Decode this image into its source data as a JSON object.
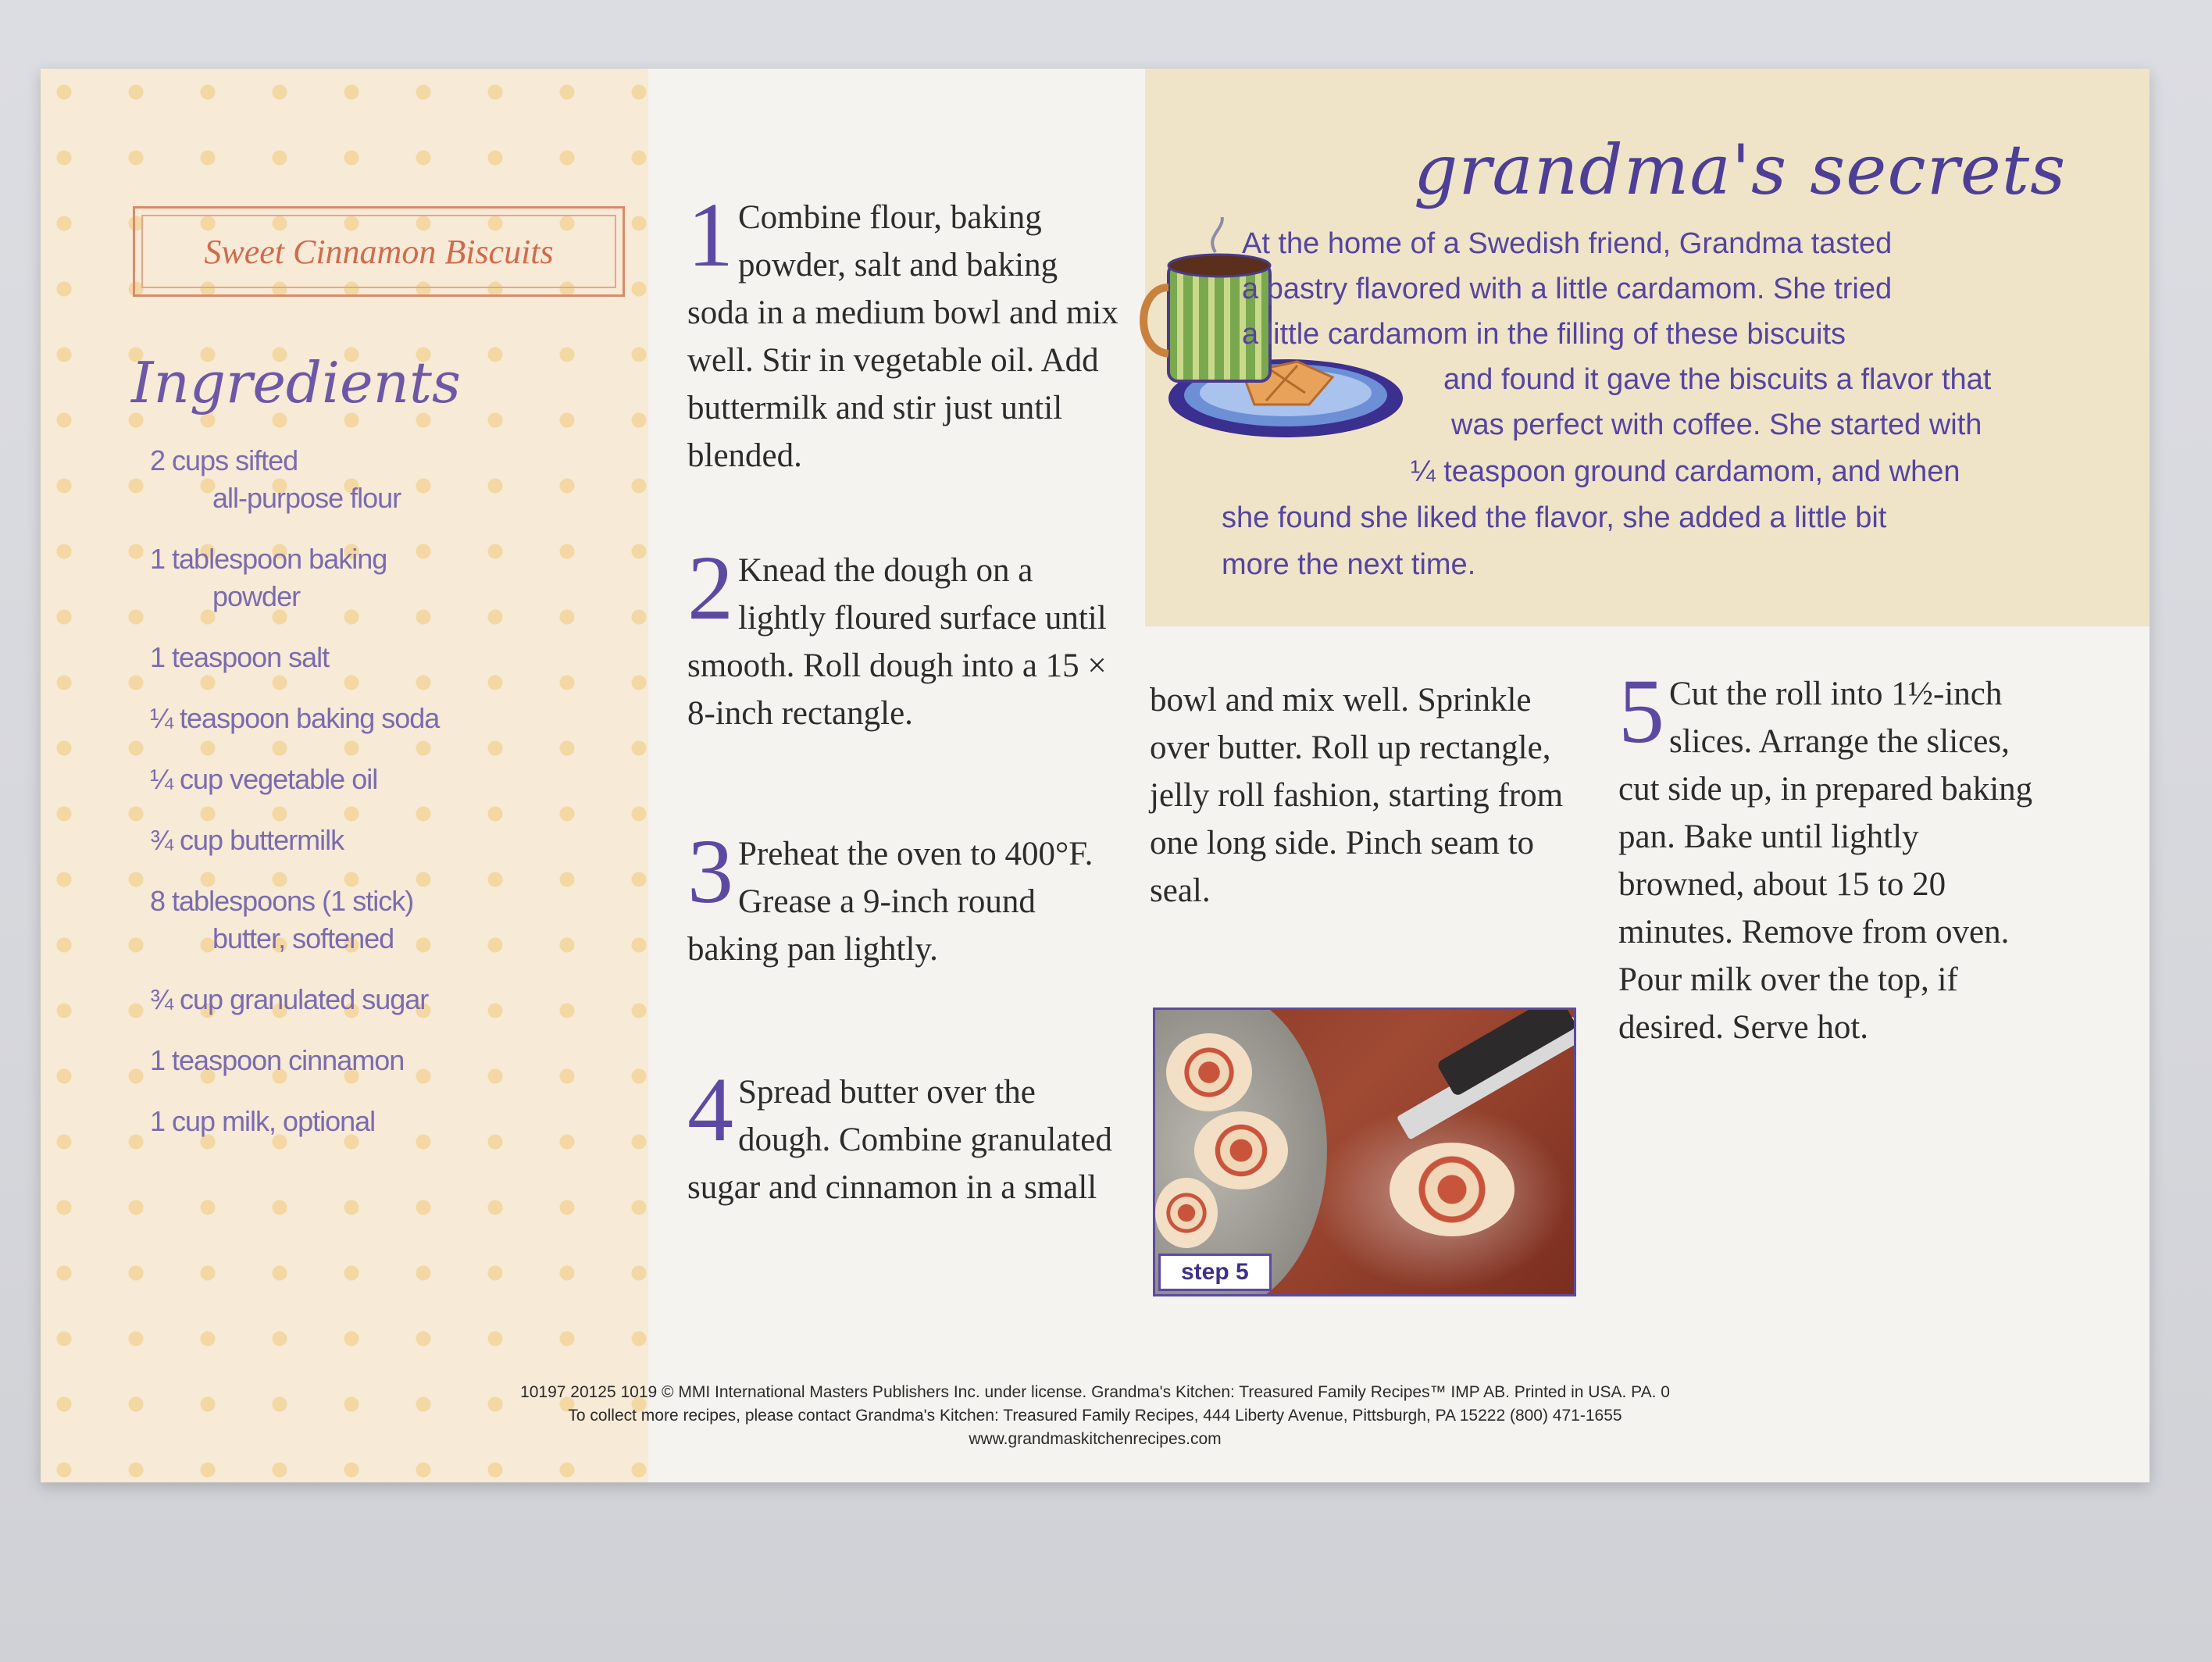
{
  "card": {
    "title": "Sweet Cinnamon Biscuits",
    "ingredients_heading": "Ingredients",
    "ingredients": [
      {
        "line1": "2 cups sifted",
        "line2": "all-purpose flour"
      },
      {
        "line1": "1 tablespoon baking",
        "line2": "powder"
      },
      {
        "line1": "1 teaspoon salt",
        "line2": ""
      },
      {
        "line1": "¼ teaspoon baking soda",
        "line2": ""
      },
      {
        "line1": "¼ cup vegetable oil",
        "line2": ""
      },
      {
        "line1": "¾ cup buttermilk",
        "line2": ""
      },
      {
        "line1": "8 tablespoons (1 stick)",
        "line2": "butter, softened"
      },
      {
        "line1": "¾ cup granulated sugar",
        "line2": ""
      },
      {
        "line1": "1 teaspoon cinnamon",
        "line2": ""
      },
      {
        "line1": "1 cup milk, optional",
        "line2": ""
      }
    ],
    "steps": [
      {
        "num": "1",
        "text": "Combine flour, baking powder, salt and baking soda in a medium bowl and mix well. Stir in vegetable oil. Add buttermilk and stir just until blended."
      },
      {
        "num": "2",
        "text": "Knead the dough on a lightly floured surface until smooth. Roll dough into a 15 × 8-inch rectangle."
      },
      {
        "num": "3",
        "text": "Preheat the oven to 400°F. Grease a 9-inch round baking pan lightly."
      },
      {
        "num": "4",
        "text": "Spread butter over the dough. Combine granulated sugar and cinnamon in a small"
      },
      {
        "num": "",
        "text": "bowl and mix well. Sprinkle over butter. Roll up rectangle, jelly roll fashion, starting from one long side. Pinch seam to seal."
      },
      {
        "num": "5",
        "text": "Cut the roll into 1½-inch slices. Arrange the slices, cut side up, in prepared baking pan. Bake until lightly browned, about 15 to 20 minutes. Remove from oven. Pour milk over the top, if desired. Serve hot."
      }
    ],
    "secrets": {
      "heading": "grandma's secrets",
      "lines": [
        "At the home of a Swedish friend, Grandma tasted",
        "a pastry flavored with a little cardamom. She tried",
        "a little cardamom in the filling of these biscuits",
        "and found it gave the biscuits a flavor that",
        "was perfect with coffee. She started with",
        "¼ teaspoon ground cardamom, and when",
        "she found she liked the flavor, she added a little bit",
        "more the next time."
      ]
    },
    "photo_label": "step 5",
    "footer": [
      "10197 20125 1019 © MMI International Masters Publishers Inc. under license. Grandma's Kitchen: Treasured Family Recipes™ IMP AB. Printed in USA. PA. 0",
      "To collect more recipes, please contact Grandma's Kitchen: Treasured Family Recipes, 444 Liberty Avenue, Pittsburgh, PA 15222 (800) 471-1655",
      "www.grandmaskitchenrecipes.com"
    ],
    "colors": {
      "accent_purple": "#5c4aa2",
      "title_red": "#cf6b4e",
      "sidebar_bg": "#f7ead6",
      "secrets_bg": "#efe4c8"
    }
  }
}
